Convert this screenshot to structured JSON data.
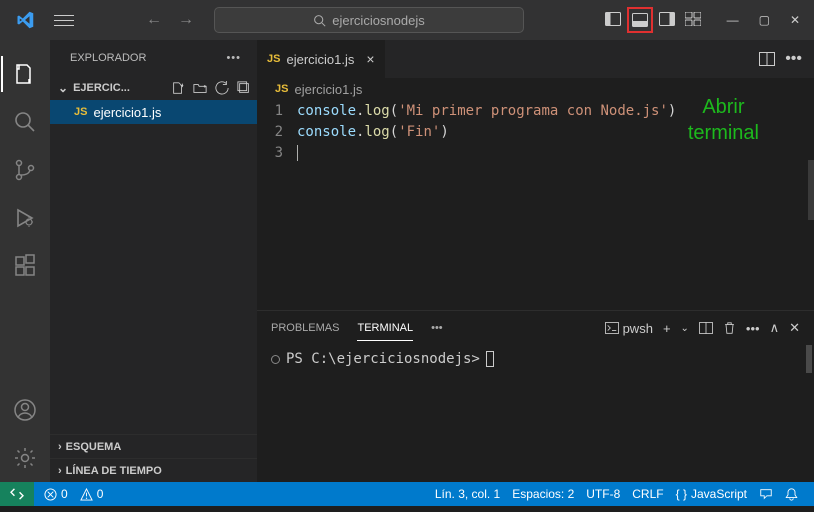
{
  "titlebar": {
    "search_placeholder": "ejerciciosnodejs"
  },
  "sidebar": {
    "title": "EXPLORADOR",
    "folder_name": "EJERCIC...",
    "file": "ejercicio1.js",
    "esquema": "ESQUEMA",
    "linea": "LÍNEA DE TIEMPO"
  },
  "editor": {
    "tab_label": "ejercicio1.js",
    "breadcrumb": "ejercicio1.js",
    "lines": {
      "n1": "1",
      "n2": "2",
      "n3": "3",
      "l1_obj": "console",
      "l1_dot": ".",
      "l1_fn": "log",
      "l1_p1": "(",
      "l1_str": "'Mi primer programa con Node.js'",
      "l1_p2": ")",
      "l2_obj": "console",
      "l2_dot": ".",
      "l2_fn": "log",
      "l2_p1": "(",
      "l2_str": "'Fin'",
      "l2_p2": ")"
    }
  },
  "annotation": {
    "l1": "Abrir",
    "l2": "terminal"
  },
  "panel": {
    "tab_problems": "PROBLEMAS",
    "tab_terminal": "TERMINAL",
    "shell_name": "pwsh",
    "prompt": "PS C:\\ejerciciosnodejs>"
  },
  "status": {
    "errors": "0",
    "warnings": "0",
    "ln_col": "Lín. 3, col. 1",
    "spaces": "Espacios: 2",
    "encoding": "UTF-8",
    "eol": "CRLF",
    "lang": "JavaScript"
  }
}
